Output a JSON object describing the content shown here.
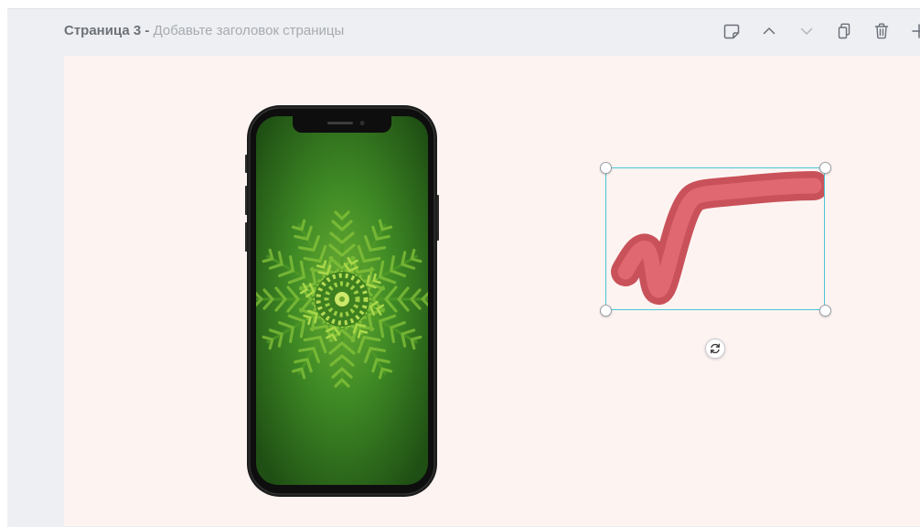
{
  "page": {
    "number_label": "Страница 3",
    "separator": " - ",
    "title_placeholder": "Добавьте заголовок страницы"
  },
  "toolbar": {
    "items": [
      {
        "icon": "note-icon",
        "action": "notes"
      },
      {
        "icon": "chevron-up-icon",
        "action": "move-page-up"
      },
      {
        "icon": "chevron-down-icon",
        "action": "move-page-down"
      },
      {
        "icon": "copy-icon",
        "action": "duplicate-page"
      },
      {
        "icon": "trash-icon",
        "action": "delete-page"
      },
      {
        "icon": "plus-icon",
        "action": "add-page"
      }
    ]
  },
  "canvas": {
    "background": "#fdf4f2",
    "elements": [
      {
        "type": "phone-mockup-image",
        "description_icon": "phone-mockup-icon"
      },
      {
        "type": "hand-drawn-checkmark",
        "color": "#d85c64",
        "selected": true
      }
    ]
  },
  "selection": {
    "border_color": "#49c6d4",
    "rotate_icon": "rotate-icon"
  }
}
